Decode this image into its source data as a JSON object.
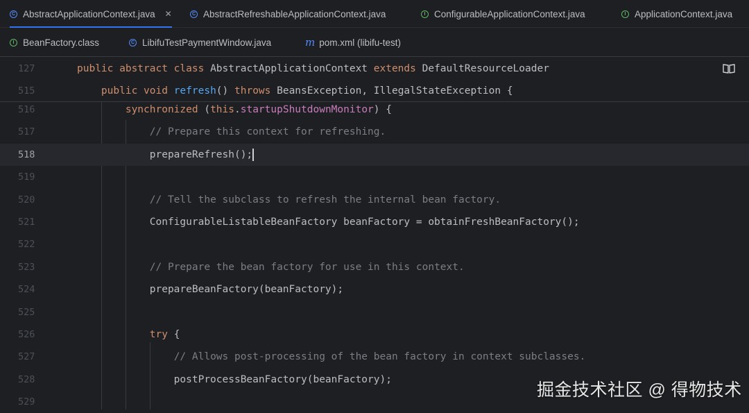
{
  "tabs_row1": [
    {
      "label": "AbstractApplicationContext.java",
      "active": true,
      "icon": "class-icon",
      "close": "✕"
    },
    {
      "label": "AbstractRefreshableApplicationContext.java",
      "icon": "class-icon"
    },
    {
      "label": "ConfigurableApplicationContext.java",
      "icon": "interface-icon"
    },
    {
      "label": "ApplicationContext.java",
      "icon": "interface-icon"
    }
  ],
  "tabs_row2": [
    {
      "label": "BeanFactory.class",
      "icon": "interface-icon"
    },
    {
      "label": "LibifuTestPaymentWindow.java",
      "icon": "class-icon"
    },
    {
      "label": "pom.xml (libifu-test)",
      "icon": "maven-icon"
    }
  ],
  "sticky": [
    {
      "num": "127",
      "code": [
        [
          "kw",
          "public abstract class "
        ],
        [
          "",
          "AbstractApplicationContext "
        ],
        [
          "kw",
          "extends "
        ],
        [
          "",
          "DefaultResourceLoader"
        ]
      ]
    },
    {
      "num": "515",
      "code": [
        [
          "",
          "    "
        ],
        [
          "kw",
          "public void "
        ],
        [
          "fn",
          "refresh"
        ],
        [
          "",
          "() "
        ],
        [
          "kw",
          "throws "
        ],
        [
          "",
          "BeansException, IllegalStateException {"
        ]
      ]
    }
  ],
  "lines": [
    {
      "num": "516",
      "code": [
        [
          "",
          "        "
        ],
        [
          "kw",
          "synchronized "
        ],
        [
          "",
          "("
        ],
        [
          "kw",
          "this"
        ],
        [
          "",
          "."
        ],
        [
          "field",
          "startupShutdownMonitor"
        ],
        [
          "",
          ") {"
        ]
      ]
    },
    {
      "num": "517",
      "code": [
        [
          "",
          "            "
        ],
        [
          "cm",
          "// Prepare this context for refreshing."
        ]
      ]
    },
    {
      "num": "518",
      "current": true,
      "code": [
        [
          "",
          "            prepareRefresh();"
        ]
      ]
    },
    {
      "num": "519",
      "code": []
    },
    {
      "num": "520",
      "code": [
        [
          "",
          "            "
        ],
        [
          "cm",
          "// Tell the subclass to refresh the internal bean factory."
        ]
      ]
    },
    {
      "num": "521",
      "code": [
        [
          "",
          "            ConfigurableListableBeanFactory beanFactory = obtainFreshBeanFactory();"
        ]
      ]
    },
    {
      "num": "522",
      "code": []
    },
    {
      "num": "523",
      "code": [
        [
          "",
          "            "
        ],
        [
          "cm",
          "// Prepare the bean factory for use in this context."
        ]
      ]
    },
    {
      "num": "524",
      "code": [
        [
          "",
          "            prepareBeanFactory(beanFactory);"
        ]
      ]
    },
    {
      "num": "525",
      "code": []
    },
    {
      "num": "526",
      "code": [
        [
          "",
          "            "
        ],
        [
          "kw",
          "try "
        ],
        [
          "",
          "{"
        ]
      ]
    },
    {
      "num": "527",
      "code": [
        [
          "",
          "                "
        ],
        [
          "cm",
          "// Allows post-processing of the bean factory in context subclasses."
        ]
      ]
    },
    {
      "num": "528",
      "code": [
        [
          "",
          "                postProcessBeanFactory(beanFactory);"
        ]
      ]
    },
    {
      "num": "529",
      "code": []
    }
  ],
  "watermark": "掘金技术社区 @ 得物技术",
  "colors": {
    "background": "#1e1f22",
    "keyword": "#cf8e6d",
    "function": "#56a8f5",
    "field": "#c77dbb",
    "comment": "#7a7e85",
    "accent": "#3574f0"
  }
}
